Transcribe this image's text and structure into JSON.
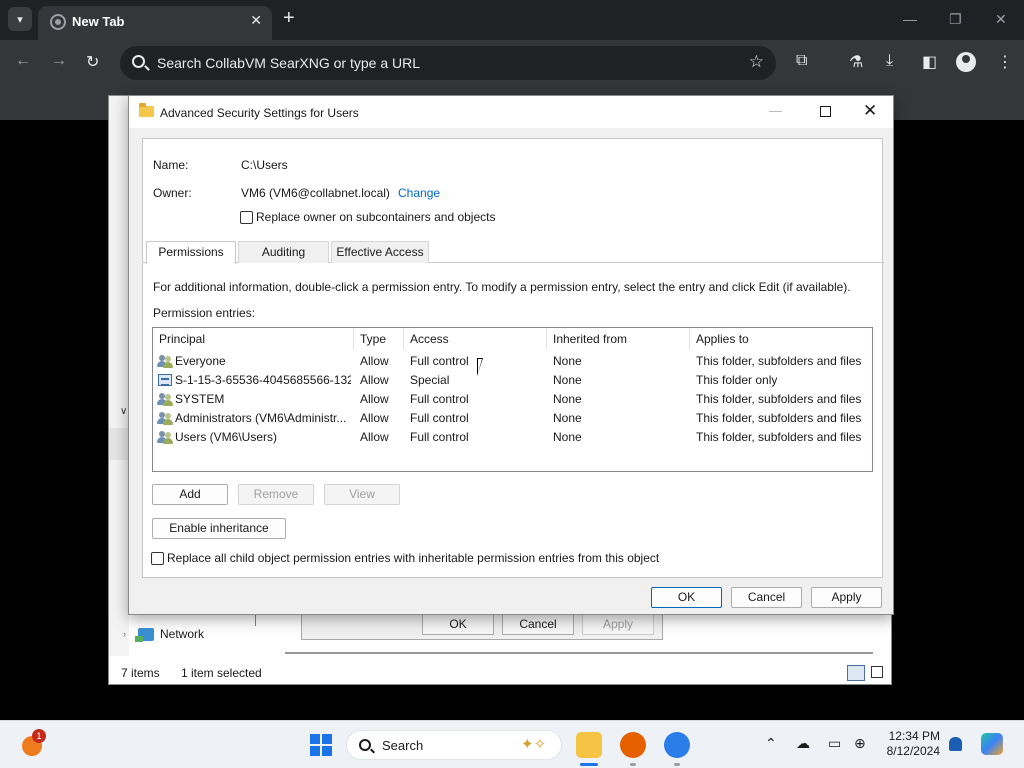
{
  "browser": {
    "tab": {
      "title": "New Tab"
    },
    "omnibox": {
      "placeholder": "Search CollabVM SearXNG or type a URL"
    }
  },
  "explorer": {
    "sidebar": {
      "network_label": "Network"
    },
    "status": {
      "items": "7 items",
      "selected": "1 item selected"
    },
    "behind_dialog": {
      "ok": "OK",
      "cancel": "Cancel",
      "apply": "Apply"
    }
  },
  "dialog": {
    "title": "Advanced Security Settings for Users",
    "name_label": "Name:",
    "name_value": "C:\\Users",
    "owner_label": "Owner:",
    "owner_value": "VM6 (VM6@collabnet.local)",
    "change_link": "Change",
    "replace_owner_label": "Replace owner on subcontainers and objects",
    "tabs": [
      {
        "label": "Permissions",
        "active": true
      },
      {
        "label": "Auditing",
        "active": false
      },
      {
        "label": "Effective Access",
        "active": false
      }
    ],
    "info_text": "For additional information, double-click a permission entry. To modify a permission entry, select the entry and click Edit (if available).",
    "entries_label": "Permission entries:",
    "columns": [
      "Principal",
      "Type",
      "Access",
      "Inherited from",
      "Applies to"
    ],
    "entries": [
      {
        "icon": "users-group-icon",
        "principal": "Everyone",
        "type": "Allow",
        "access": "Full control",
        "inherited": "None",
        "applies": "This folder, subfolders and files"
      },
      {
        "icon": "sid-icon",
        "principal": "S-1-15-3-65536-4045685566-132...",
        "type": "Allow",
        "access": "Special",
        "inherited": "None",
        "applies": "This folder only"
      },
      {
        "icon": "users-group-icon",
        "principal": "SYSTEM",
        "type": "Allow",
        "access": "Full control",
        "inherited": "None",
        "applies": "This folder, subfolders and files"
      },
      {
        "icon": "users-group-icon",
        "principal": "Administrators (VM6\\Administr...",
        "type": "Allow",
        "access": "Full control",
        "inherited": "None",
        "applies": "This folder, subfolders and files"
      },
      {
        "icon": "users-group-icon",
        "principal": "Users (VM6\\Users)",
        "type": "Allow",
        "access": "Full control",
        "inherited": "None",
        "applies": "This folder, subfolders and files"
      }
    ],
    "buttons": {
      "add": "Add",
      "remove": "Remove",
      "view": "View",
      "enable_inheritance": "Enable inheritance",
      "ok": "OK",
      "cancel": "Cancel",
      "apply": "Apply"
    },
    "replace_child_label": "Replace all child object permission entries with inheritable permission entries from this object"
  },
  "taskbar": {
    "search_placeholder": "Search",
    "widget_badge": "1",
    "time": "12:34 PM",
    "date": "8/12/2024"
  },
  "colors": {
    "accent": "#0067c0",
    "link": "#0066cc",
    "chrome_dark": "#202124"
  }
}
